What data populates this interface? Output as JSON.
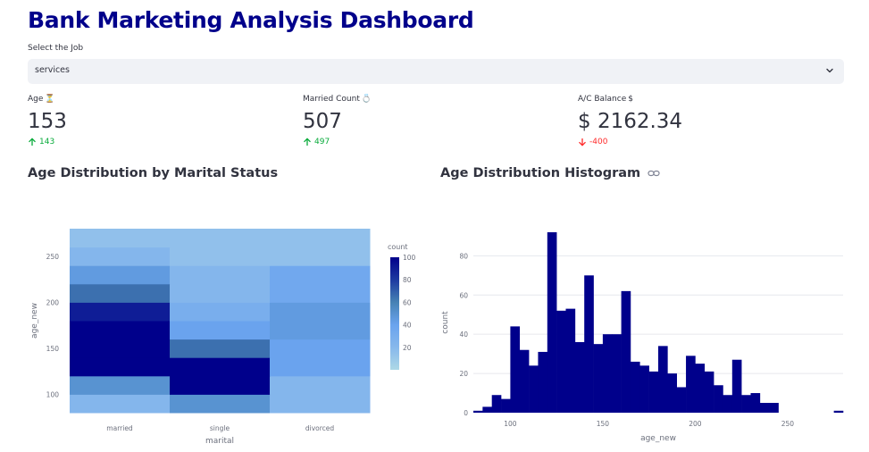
{
  "page": {
    "title": "Bank Marketing Analysis Dashboard"
  },
  "job_select": {
    "label": "Select the Job",
    "value": "services"
  },
  "metrics": [
    {
      "label": "Age",
      "icon": "hourglass-icon",
      "icon_glyph": "⏳",
      "value": "153",
      "delta": "143",
      "direction": "up"
    },
    {
      "label": "Married Count",
      "icon": "ring-icon",
      "icon_glyph": "💍",
      "value": "507",
      "delta": "497",
      "direction": "up"
    },
    {
      "label": "A/C Balance",
      "icon": "dollar-icon",
      "icon_glyph": "$",
      "value": "$ 2162.34",
      "delta": "-400",
      "direction": "down"
    }
  ],
  "sections": {
    "heatmap_title": "Age Distribution by Marital Status",
    "histogram_title": "Age Distribution Histogram"
  },
  "colors": {
    "title": "#00008b",
    "bar": "#00008b",
    "delta_up": "#09ab3b",
    "delta_down": "#ff2b2b",
    "select_bg": "#f0f2f6",
    "colorscale": [
      "#add8e6",
      "#87b8ec",
      "#6aa3ee",
      "#4682b4",
      "#1e3aa0",
      "#00008b"
    ]
  },
  "chart_data": [
    {
      "type": "heatmap",
      "xlabel": "marital",
      "ylabel": "age_new",
      "categories": [
        "married",
        "single",
        "divorced"
      ],
      "y_bins": [
        [
          80,
          100
        ],
        [
          100,
          120
        ],
        [
          120,
          140
        ],
        [
          140,
          160
        ],
        [
          160,
          180
        ],
        [
          180,
          200
        ],
        [
          200,
          220
        ],
        [
          220,
          240
        ],
        [
          240,
          260
        ],
        [
          260,
          280
        ]
      ],
      "y_ticks": [
        100,
        150,
        200,
        250
      ],
      "y_range": [
        80,
        280
      ],
      "colorbar": {
        "title": "count",
        "range": [
          0,
          100
        ],
        "ticks": [
          20,
          40,
          60,
          80,
          100
        ]
      },
      "z": [
        [
          22,
          50,
          22
        ],
        [
          50,
          100,
          22
        ],
        [
          100,
          100,
          40
        ],
        [
          100,
          65,
          40
        ],
        [
          100,
          40,
          45
        ],
        [
          90,
          30,
          45
        ],
        [
          65,
          22,
          35
        ],
        [
          45,
          22,
          35
        ],
        [
          22,
          15,
          15
        ],
        [
          15,
          15,
          15
        ]
      ]
    },
    {
      "type": "bar",
      "title": "",
      "xlabel": "age_new",
      "ylabel": "count",
      "x_ticks": [
        100,
        150,
        200,
        250
      ],
      "y_ticks": [
        0,
        20,
        40,
        60,
        80
      ],
      "xlim": [
        80,
        280
      ],
      "ylim": [
        0,
        92
      ],
      "bin_width": 5,
      "bins": [
        {
          "x": 80,
          "count": 1
        },
        {
          "x": 85,
          "count": 3
        },
        {
          "x": 90,
          "count": 9
        },
        {
          "x": 95,
          "count": 7
        },
        {
          "x": 100,
          "count": 44
        },
        {
          "x": 105,
          "count": 32
        },
        {
          "x": 110,
          "count": 24
        },
        {
          "x": 115,
          "count": 31
        },
        {
          "x": 120,
          "count": 92
        },
        {
          "x": 125,
          "count": 52
        },
        {
          "x": 130,
          "count": 53
        },
        {
          "x": 135,
          "count": 36
        },
        {
          "x": 140,
          "count": 70
        },
        {
          "x": 145,
          "count": 35
        },
        {
          "x": 150,
          "count": 40
        },
        {
          "x": 155,
          "count": 40
        },
        {
          "x": 160,
          "count": 62
        },
        {
          "x": 165,
          "count": 26
        },
        {
          "x": 170,
          "count": 24
        },
        {
          "x": 175,
          "count": 21
        },
        {
          "x": 180,
          "count": 34
        },
        {
          "x": 185,
          "count": 20
        },
        {
          "x": 190,
          "count": 13
        },
        {
          "x": 195,
          "count": 29
        },
        {
          "x": 200,
          "count": 25
        },
        {
          "x": 205,
          "count": 21
        },
        {
          "x": 210,
          "count": 14
        },
        {
          "x": 215,
          "count": 9
        },
        {
          "x": 220,
          "count": 27
        },
        {
          "x": 225,
          "count": 9
        },
        {
          "x": 230,
          "count": 10
        },
        {
          "x": 235,
          "count": 5
        },
        {
          "x": 240,
          "count": 5
        },
        {
          "x": 275,
          "count": 1
        }
      ]
    }
  ]
}
